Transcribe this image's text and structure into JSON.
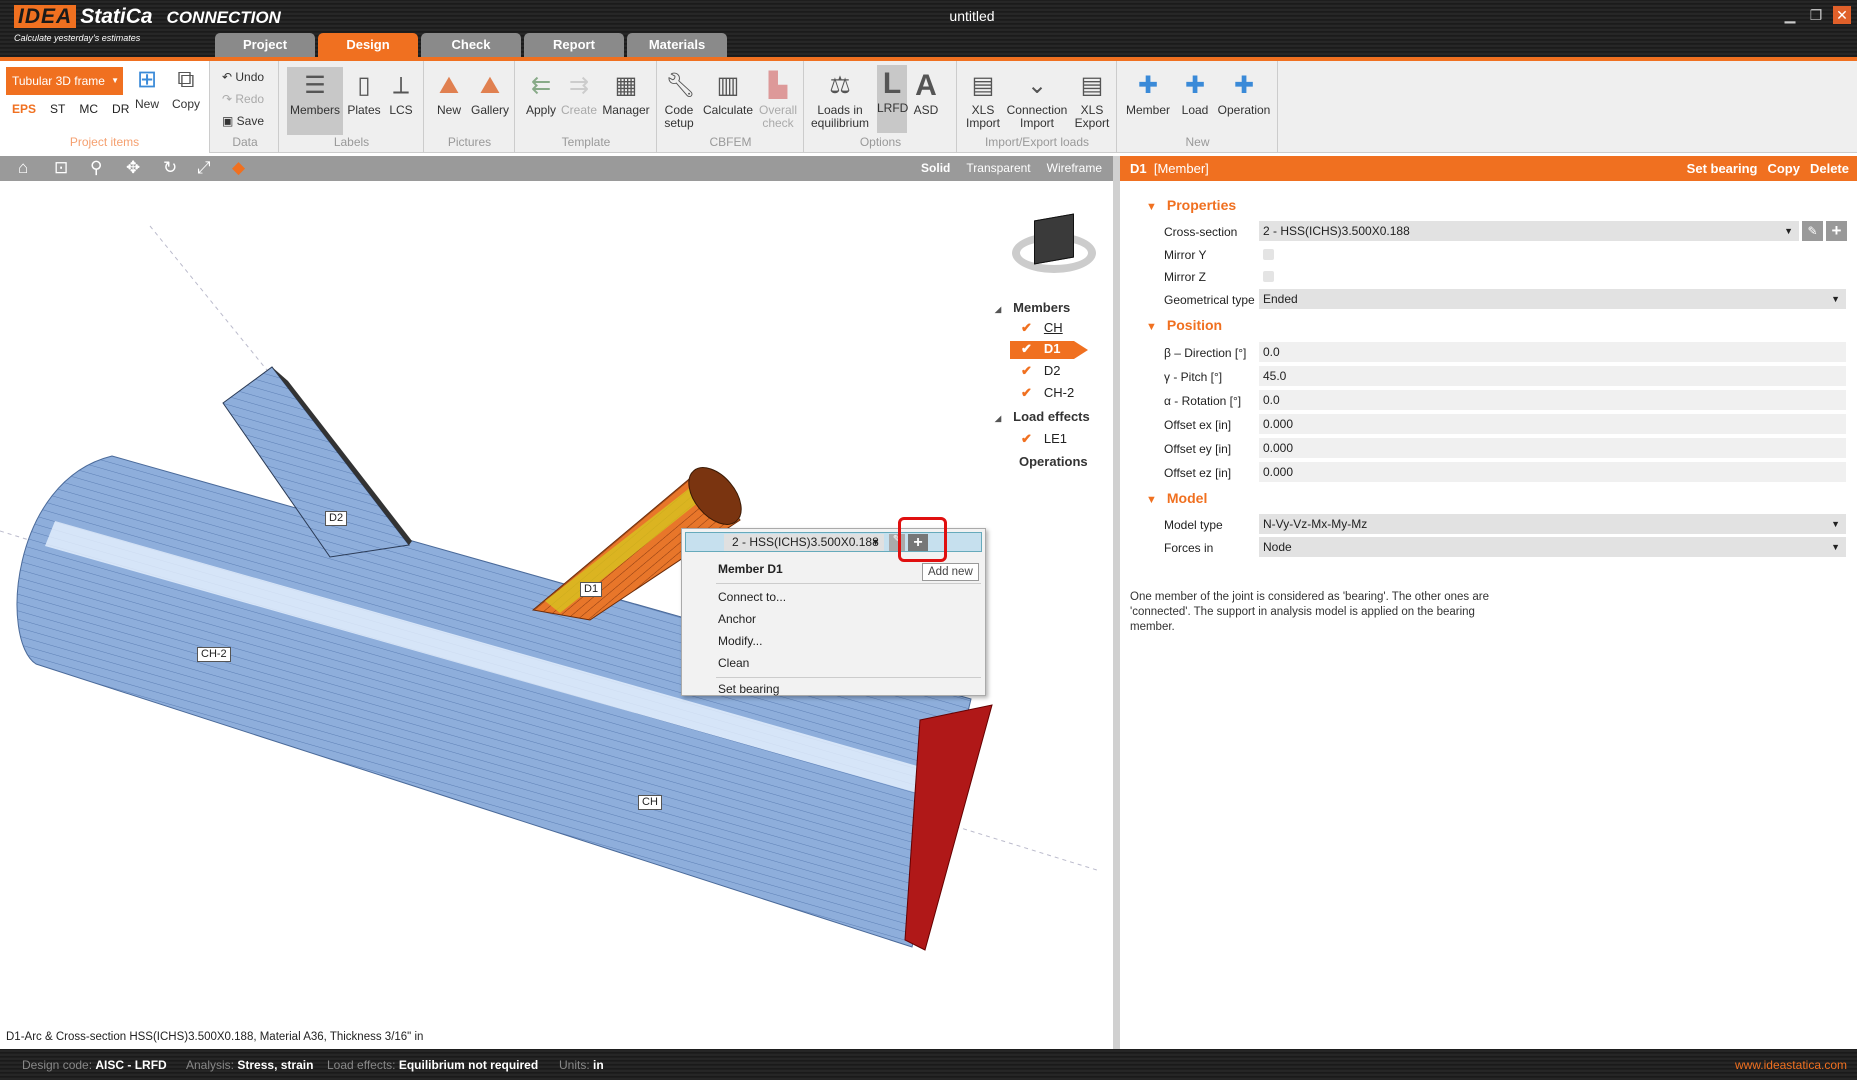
{
  "app": {
    "logo": "IDEA StatiCa",
    "logo_brand": "IDEA",
    "logo_name": "StatiCa",
    "product": "CONNECTION",
    "tagline": "Calculate yesterday's estimates",
    "title": "untitled"
  },
  "tabs": [
    {
      "label": "Project"
    },
    {
      "label": "Design"
    },
    {
      "label": "Check"
    },
    {
      "label": "Report"
    },
    {
      "label": "Materials"
    }
  ],
  "ribbon": {
    "project_items": {
      "dropdown": "Tubular 3D frame",
      "types": [
        "EPS",
        "ST",
        "MC",
        "DR"
      ],
      "new": "New",
      "copy": "Copy",
      "label": "Project items"
    },
    "data": {
      "undo": "Undo",
      "redo": "Redo",
      "save": "Save",
      "label": "Data"
    },
    "labels": {
      "members": "Members",
      "plates": "Plates",
      "lcs": "LCS",
      "label": "Labels"
    },
    "pictures": {
      "new": "New",
      "gallery": "Gallery",
      "label": "Pictures"
    },
    "template": {
      "apply": "Apply",
      "create": "Create",
      "manager": "Manager",
      "label": "Template"
    },
    "cbfem": {
      "code_setup_1": "Code",
      "code_setup_2": "setup",
      "calculate": "Calculate",
      "overall_1": "Overall",
      "overall_2": "check",
      "label": "CBFEM"
    },
    "options": {
      "loads_1": "Loads in",
      "loads_2": "equilibrium",
      "lrfd": "LRFD",
      "asd": "ASD",
      "label": "Options"
    },
    "import_export": {
      "xls_import_1": "XLS",
      "xls_import_2": "Import",
      "conn_import_1": "Connection",
      "conn_import_2": "Import",
      "xls_export_1": "XLS",
      "xls_export_2": "Export",
      "label": "Import/Export loads"
    },
    "new": {
      "member": "Member",
      "load": "Load",
      "operation": "Operation",
      "label": "New"
    }
  },
  "view_modes": [
    "Solid",
    "Transparent",
    "Wireframe"
  ],
  "tree": {
    "members_header": "Members",
    "members": [
      "CH",
      "D1",
      "D2",
      "CH-2"
    ],
    "load_effects_header": "Load effects",
    "load_effects": [
      "LE1"
    ],
    "operations_header": "Operations"
  },
  "labels3d": {
    "d2": "D2",
    "d1": "D1",
    "ch2": "CH-2",
    "ch": "CH"
  },
  "context_menu": {
    "cross_section": "2 - HSS(ICHS)3.500X0.188",
    "title": "Member D1",
    "items": [
      "Connect to...",
      "Anchor",
      "Modify...",
      "Clean"
    ],
    "set_bearing": "Set bearing",
    "tooltip": "Add new"
  },
  "panel": {
    "name": "D1",
    "type": "[Member]",
    "actions": [
      "Set bearing",
      "Copy",
      "Delete"
    ],
    "properties": {
      "header": "Properties",
      "cross_section_label": "Cross-section",
      "cross_section": "2 - HSS(ICHS)3.500X0.188",
      "mirror_y": "Mirror Y",
      "mirror_z": "Mirror Z",
      "geo_type_label": "Geometrical type",
      "geo_type": "Ended"
    },
    "position": {
      "header": "Position",
      "rows": [
        {
          "label": "β – Direction [°]",
          "value": "0.0"
        },
        {
          "label": "γ - Pitch [°]",
          "value": "45.0"
        },
        {
          "label": "α - Rotation [°]",
          "value": "0.0"
        },
        {
          "label": "Offset ex [in]",
          "value": "0.000"
        },
        {
          "label": "Offset ey [in]",
          "value": "0.000"
        },
        {
          "label": "Offset ez [in]",
          "value": "0.000"
        }
      ]
    },
    "model": {
      "header": "Model",
      "model_type_label": "Model type",
      "model_type": "N-Vy-Vz-Mx-My-Mz",
      "forces_in_label": "Forces in",
      "forces_in": "Node"
    },
    "description": "One member of the joint is considered as 'bearing'. The other ones are 'connected'. The support in analysis model is applied on the bearing member."
  },
  "status_text": "D1-Arc & Cross-section HSS(ICHS)3.500X0.188, Material A36, Thickness 3/16\" in",
  "bottom": {
    "design_code_label": "Design code:",
    "design_code": "AISC - LRFD",
    "analysis_label": "Analysis:",
    "analysis": "Stress, strain",
    "load_effects_label": "Load effects:",
    "load_effects": "Equilibrium not required",
    "units_label": "Units:",
    "units": "in",
    "website": "www.ideastatica.com"
  },
  "colors": {
    "accent": "#f07020",
    "tube": "#8eaedb",
    "selected": "#e8762a",
    "plate": "#b01818"
  }
}
